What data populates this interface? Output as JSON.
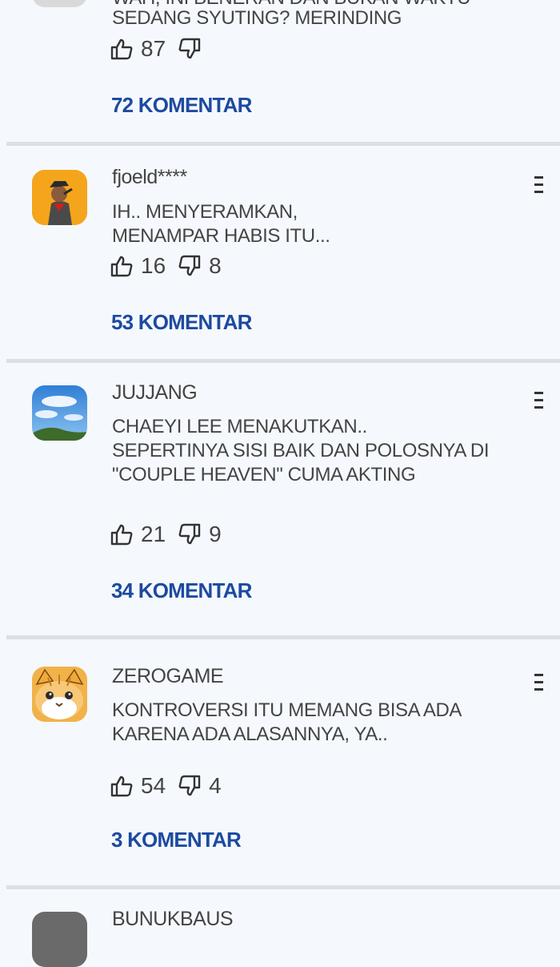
{
  "comments": [
    {
      "lines": [
        "WAH, INI BENERAN DAN BUKAN WAKTU",
        "SEDANG SYUTING?  MERINDING"
      ],
      "likes": "87",
      "dislikes": "",
      "comments_link": "72 KOMENTAR"
    },
    {
      "username": "fjoeld****",
      "lines": [
        "IH.. MENYERAMKAN,",
        "MENAMPAR HABIS ITU..."
      ],
      "likes": "16",
      "dislikes": "8",
      "comments_link": "53 KOMENTAR"
    },
    {
      "username": "JUJJANG",
      "lines": [
        "CHAEYI LEE MENAKUTKAN..",
        "SEPERTINYA SISI BAIK DAN POLOSNYA DI",
        "\"COUPLE HEAVEN\" CUMA AKTING"
      ],
      "likes": "21",
      "dislikes": "9",
      "comments_link": "34 KOMENTAR"
    },
    {
      "username": "ZEROGAME",
      "lines": [
        "KONTROVERSI ITU MEMANG BISA ADA",
        "KARENA ADA ALASANNYA, YA.."
      ],
      "likes": "54",
      "dislikes": "4",
      "comments_link": "3 KOMENTAR"
    },
    {
      "username": "BUNUKBAUS"
    }
  ],
  "icons": {
    "like": "thumbs-up-outline",
    "dislike": "thumbs-down-outline",
    "menu": "more-menu"
  },
  "colors": {
    "background": "#f5f9fd",
    "link": "#1d4aa0",
    "divider": "#dcdfe3"
  }
}
